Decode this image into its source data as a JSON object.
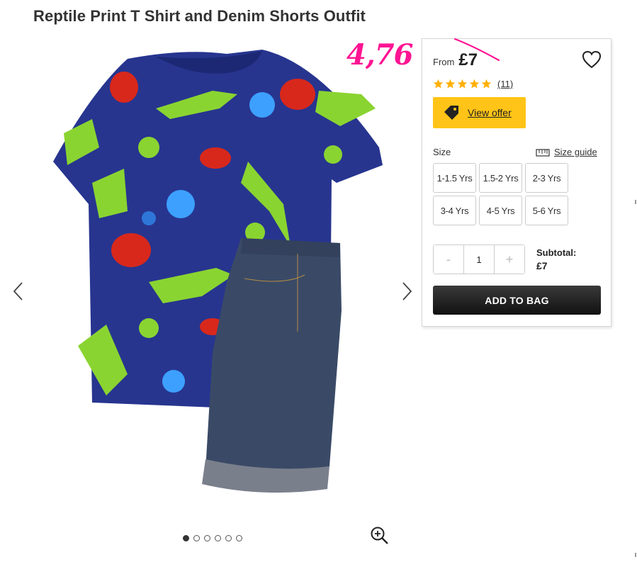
{
  "product": {
    "title": "Reptile Print T Shirt and Denim Shorts Outfit"
  },
  "promo_annotation": "4,76",
  "price": {
    "from_label": "From",
    "value": "£7"
  },
  "rating": {
    "stars": 5,
    "count_label": "(11)"
  },
  "offer": {
    "label": "View offer"
  },
  "size": {
    "label": "Size",
    "guide_label": "Size guide",
    "options": [
      "1-1.5 Yrs",
      "1.5-2 Yrs",
      "2-3 Yrs",
      "3-4 Yrs",
      "4-5 Yrs",
      "5-6 Yrs"
    ]
  },
  "quantity": {
    "minus": "-",
    "value": "1",
    "plus": "+"
  },
  "subtotal": {
    "label": "Subtotal:",
    "value": "£7"
  },
  "add_to_bag": "ADD TO BAG",
  "gallery": {
    "image_count": 6,
    "active_index": 0
  },
  "colors": {
    "offer_button": "#ffc417",
    "promo_text": "#ff1493",
    "star": "#ffb000",
    "tee": "#27358f",
    "denim": "#3a4a66"
  },
  "icons": [
    "chevron-left-icon",
    "chevron-right-icon",
    "zoom-in-icon",
    "heart-icon",
    "star-icon",
    "tag-icon",
    "ruler-icon"
  ]
}
